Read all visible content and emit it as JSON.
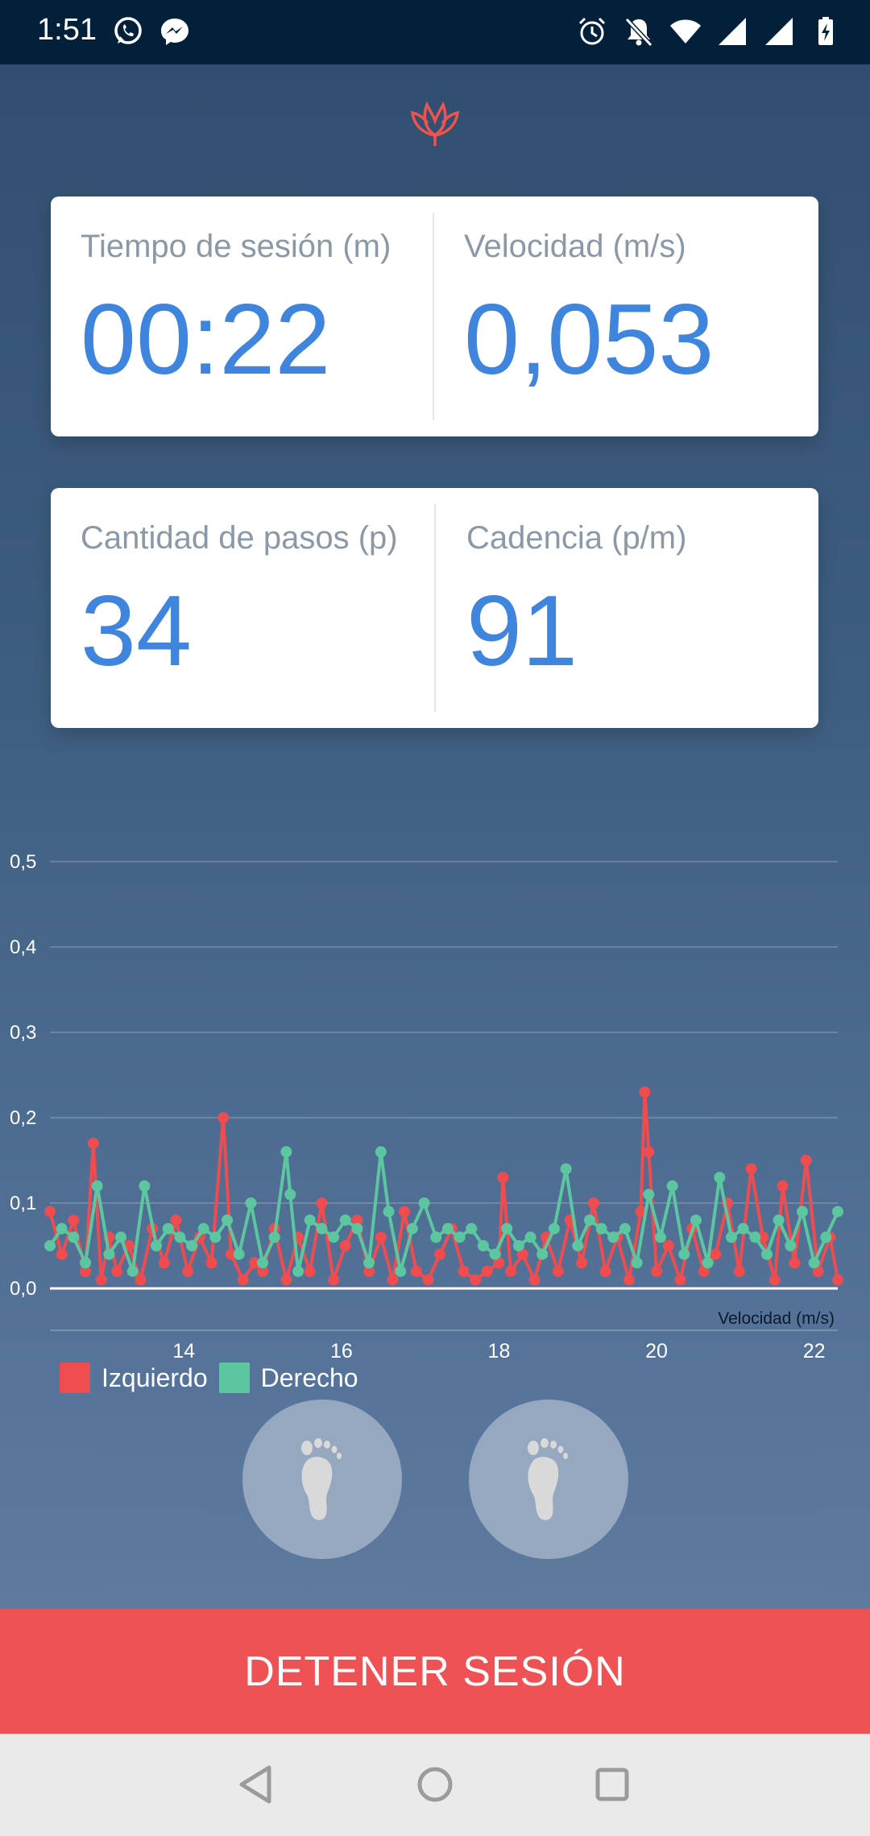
{
  "status_bar": {
    "time": "1:51",
    "left_icons": [
      "whatsapp-icon",
      "messenger-icon"
    ],
    "right_icons": [
      "alarm-icon",
      "bell-off-icon",
      "wifi-icon",
      "signal-icon",
      "signal-icon",
      "battery-charging-icon"
    ]
  },
  "logo_icon": "lotus-icon",
  "stats": {
    "session_time_label": "Tiempo de sesión (m)",
    "session_time_value": "00:22",
    "speed_label": "Velocidad (m/s)",
    "speed_value": "0,053",
    "steps_label": "Cantidad de pasos (p)",
    "steps_value": "34",
    "cadence_label": "Cadencia (p/m)",
    "cadence_value": "91"
  },
  "chart_data": {
    "type": "line",
    "description_label": "Velocidad (m/s)",
    "y_ticks": [
      "0,0",
      "0,1",
      "0,2",
      "0,3",
      "0,4",
      "0,5"
    ],
    "ylim": [
      0,
      0.5
    ],
    "x_ticks": [
      "14",
      "16",
      "18",
      "20",
      "22"
    ],
    "x_tick_values": [
      14,
      16,
      18,
      20,
      22
    ],
    "xlim": [
      12.3,
      22.3
    ],
    "grid": true,
    "legend_position": "bottom-left",
    "series": [
      {
        "name": "Izquierdo",
        "color": "#ee4c4f",
        "x": [
          12.3,
          12.45,
          12.6,
          12.75,
          12.85,
          12.95,
          13.05,
          13.15,
          13.3,
          13.45,
          13.6,
          13.75,
          13.9,
          14.05,
          14.2,
          14.35,
          14.5,
          14.6,
          14.75,
          14.9,
          15.0,
          15.15,
          15.3,
          15.45,
          15.6,
          15.75,
          15.9,
          16.05,
          16.2,
          16.35,
          16.5,
          16.65,
          16.8,
          16.95,
          17.1,
          17.25,
          17.4,
          17.55,
          17.7,
          17.85,
          18.0,
          18.05,
          18.15,
          18.3,
          18.45,
          18.6,
          18.75,
          18.9,
          19.05,
          19.2,
          19.35,
          19.5,
          19.65,
          19.8,
          19.85,
          19.9,
          20.0,
          20.15,
          20.3,
          20.45,
          20.6,
          20.75,
          20.9,
          21.05,
          21.2,
          21.35,
          21.5,
          21.6,
          21.75,
          21.9,
          22.05,
          22.2,
          22.3
        ],
        "y": [
          0.09,
          0.04,
          0.08,
          0.02,
          0.17,
          0.01,
          0.06,
          0.02,
          0.05,
          0.01,
          0.07,
          0.03,
          0.08,
          0.02,
          0.06,
          0.03,
          0.2,
          0.04,
          0.01,
          0.03,
          0.02,
          0.07,
          0.01,
          0.06,
          0.02,
          0.1,
          0.01,
          0.05,
          0.08,
          0.02,
          0.06,
          0.01,
          0.09,
          0.02,
          0.01,
          0.04,
          0.07,
          0.02,
          0.01,
          0.02,
          0.03,
          0.13,
          0.02,
          0.04,
          0.01,
          0.06,
          0.02,
          0.08,
          0.03,
          0.1,
          0.02,
          0.06,
          0.01,
          0.09,
          0.23,
          0.16,
          0.02,
          0.05,
          0.01,
          0.07,
          0.02,
          0.04,
          0.1,
          0.02,
          0.14,
          0.06,
          0.01,
          0.12,
          0.03,
          0.15,
          0.02,
          0.06,
          0.01
        ]
      },
      {
        "name": "Derecho",
        "color": "#5cc6a0",
        "x": [
          12.3,
          12.45,
          12.6,
          12.75,
          12.9,
          13.05,
          13.2,
          13.35,
          13.5,
          13.65,
          13.8,
          13.95,
          14.1,
          14.25,
          14.4,
          14.55,
          14.7,
          14.85,
          15.0,
          15.15,
          15.3,
          15.35,
          15.45,
          15.6,
          15.75,
          15.9,
          16.05,
          16.2,
          16.35,
          16.5,
          16.6,
          16.75,
          16.9,
          17.05,
          17.2,
          17.35,
          17.5,
          17.65,
          17.8,
          17.95,
          18.1,
          18.25,
          18.4,
          18.55,
          18.7,
          18.85,
          19.0,
          19.15,
          19.3,
          19.45,
          19.6,
          19.75,
          19.9,
          20.05,
          20.2,
          20.35,
          20.5,
          20.65,
          20.8,
          20.95,
          21.1,
          21.25,
          21.4,
          21.55,
          21.7,
          21.85,
          22.0,
          22.15,
          22.3
        ],
        "y": [
          0.05,
          0.07,
          0.06,
          0.03,
          0.12,
          0.04,
          0.06,
          0.02,
          0.12,
          0.05,
          0.07,
          0.06,
          0.05,
          0.07,
          0.06,
          0.08,
          0.04,
          0.1,
          0.03,
          0.06,
          0.16,
          0.11,
          0.02,
          0.08,
          0.07,
          0.06,
          0.08,
          0.07,
          0.03,
          0.16,
          0.09,
          0.02,
          0.07,
          0.1,
          0.06,
          0.07,
          0.06,
          0.07,
          0.05,
          0.04,
          0.07,
          0.05,
          0.06,
          0.04,
          0.07,
          0.14,
          0.05,
          0.08,
          0.07,
          0.06,
          0.07,
          0.03,
          0.11,
          0.06,
          0.12,
          0.04,
          0.08,
          0.03,
          0.13,
          0.06,
          0.07,
          0.06,
          0.04,
          0.08,
          0.05,
          0.09,
          0.03,
          0.06,
          0.09
        ]
      }
    ]
  },
  "controls": {
    "foot_icon": "footprint-icon",
    "stop_label": "DETENER SESIÓN"
  },
  "nav_bar": {
    "back_icon": "back-triangle-icon",
    "home_icon": "home-circle-icon",
    "recent_icon": "recents-square-icon"
  }
}
